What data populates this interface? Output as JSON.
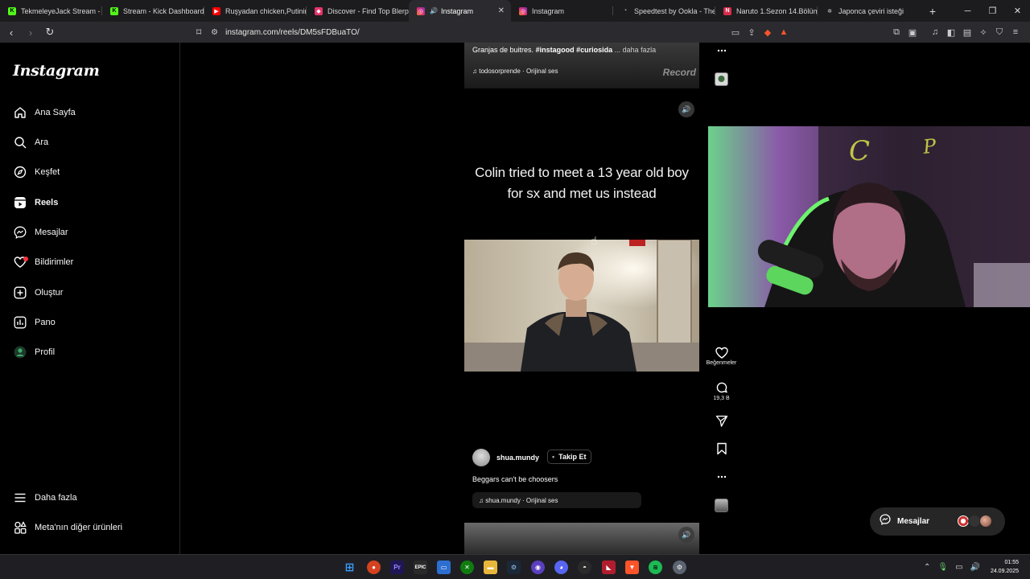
{
  "browser": {
    "tabs": [
      {
        "title": "TekmeleyeJack Stream - W",
        "icon": "kick-icon",
        "color": "#53fc18"
      },
      {
        "title": "Stream - Kick Dashboard",
        "icon": "kick-icon",
        "color": "#53fc18"
      },
      {
        "title": "Ruşyadan chicken,Putinin",
        "icon": "youtube-icon",
        "color": "#ff0000"
      },
      {
        "title": "Discover - Find Top Blerps",
        "icon": "blerp-icon",
        "color": "#e8336b"
      },
      {
        "title": "Instagram",
        "icon": "instagram-icon",
        "color": "#e1306c",
        "active": true
      },
      {
        "title": "Instagram",
        "icon": "instagram-icon",
        "color": "#e1306c"
      },
      {
        "title": "Speedtest by Ookla - The",
        "icon": "speedtest-icon",
        "color": "#777777"
      },
      {
        "title": "Naruto 1.Sezon 14.Bölüm",
        "icon": "anime-icon",
        "color": "#d92b4a"
      },
      {
        "title": "Japonca çeviri isteği",
        "icon": "chatgpt-icon",
        "color": "#888888"
      }
    ],
    "url": "instagram.com/reels/DM5sFDBuaTO/"
  },
  "sidebar": {
    "logo": "Instagram",
    "items": [
      {
        "label": "Ana Sayfa",
        "icon": "home-icon"
      },
      {
        "label": "Ara",
        "icon": "search-icon"
      },
      {
        "label": "Keşfet",
        "icon": "compass-icon"
      },
      {
        "label": "Reels",
        "icon": "reels-icon",
        "active": true
      },
      {
        "label": "Mesajlar",
        "icon": "messenger-icon"
      },
      {
        "label": "Bildirimler",
        "icon": "heart-icon",
        "badge": true
      },
      {
        "label": "Oluştur",
        "icon": "plus-square-icon"
      },
      {
        "label": "Pano",
        "icon": "chart-icon"
      },
      {
        "label": "Profil",
        "icon": "profile-avatar"
      }
    ],
    "bottom": [
      {
        "label": "Daha fazla",
        "icon": "menu-icon"
      },
      {
        "label": "Meta'nın diğer ürünleri",
        "icon": "grid-icon"
      }
    ]
  },
  "reel_prev": {
    "caption": "Granjas de buitres.",
    "hashtags": "#instagood #curiosida",
    "more": "... daha fazla",
    "audio": "todosorprende · Orijinal ses",
    "watermark": "Record"
  },
  "reel": {
    "caption_line1": "Colin tried to meet a 13 year old boy",
    "caption_line2": "for sx and met us instead",
    "username": "shua.mundy",
    "follow": "Takip Et",
    "description": "Beggars can't be choosers",
    "audio": "shua.mundy · Orijinal ses",
    "like_label": "Beğenmeler",
    "comment_count": "19,3 B"
  },
  "messages_pill": {
    "label": "Mesajlar"
  },
  "taskbar": {
    "time": "01:55",
    "date": "24.09.2025"
  }
}
